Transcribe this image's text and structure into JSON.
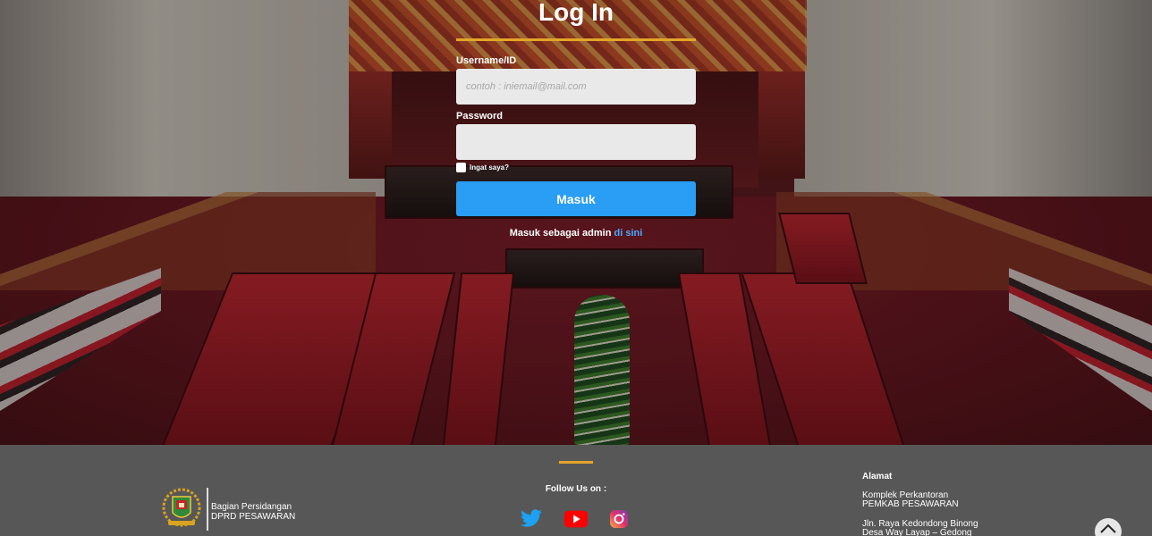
{
  "login": {
    "title": "Log In",
    "username_label": "Username/ID",
    "username_placeholder": "contoh : iniemail@mail.com",
    "username_value": "",
    "password_label": "Password",
    "password_value": "",
    "remember_label": "Ingat saya?",
    "remember_checked": false,
    "submit_label": "Masuk",
    "admin_text": "Masuk sebagai admin",
    "admin_link": "di sini"
  },
  "footer": {
    "org_line1": "Bagian Persidangan",
    "org_line2": "DPRD PESAWARAN",
    "follow_label": "Follow Us on :",
    "social": [
      {
        "name": "twitter-icon",
        "color": "#1da1f2"
      },
      {
        "name": "youtube-icon",
        "color": "#ff0000"
      },
      {
        "name": "instagram-icon",
        "color": "#d6249f"
      }
    ],
    "address_title": "Alamat",
    "address_line1": "Komplek Perkantoran",
    "address_line2": "PEMKAB PESAWARAN",
    "address_line3": "Jln. Raya Kedondong Binong",
    "address_line4": "Desa Way Layap – Gedong"
  },
  "colors": {
    "accent": "#e3a528",
    "button": "#2a9df4",
    "link": "#4aa8ff",
    "footer_bg": "#575757"
  }
}
